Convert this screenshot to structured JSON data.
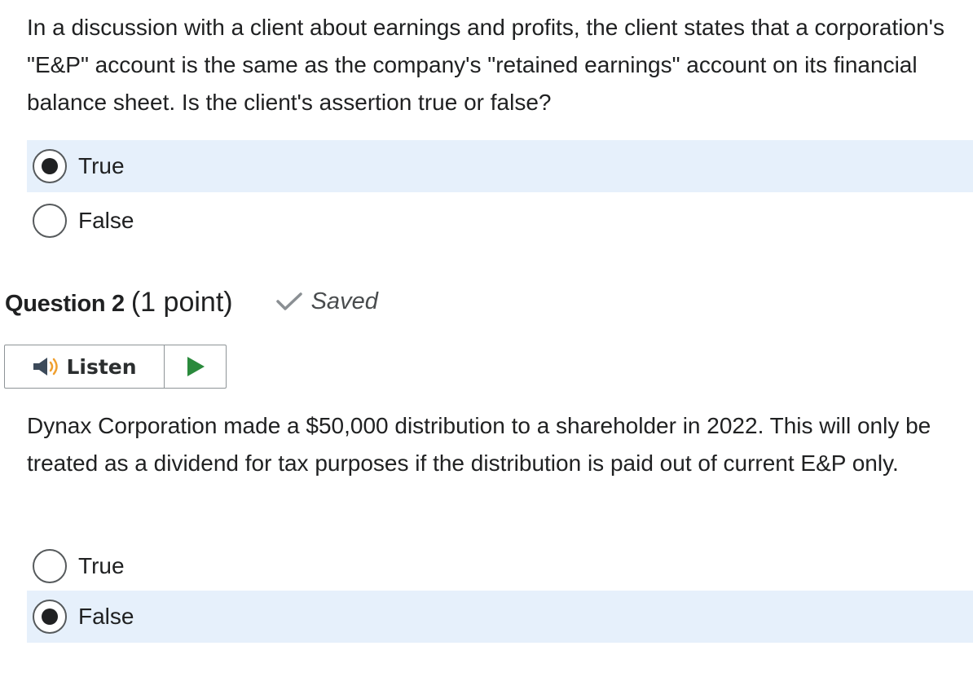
{
  "question1": {
    "text": "In a discussion with a client about earnings and profits, the client states that a corporation's \"E&P\" account is the same as the company's \"retained earnings\" account on its financial balance sheet. Is the client's assertion true or false?",
    "options": [
      {
        "label": "True",
        "selected": true
      },
      {
        "label": "False",
        "selected": false
      }
    ]
  },
  "question2": {
    "number_label": "Question 2",
    "points_label": "(1 point)",
    "status_label": "Saved",
    "listen_label": "Listen",
    "text": "Dynax Corporation made a $50,000 distribution to a shareholder in 2022. This will only be treated as a dividend for tax purposes if the distribution is paid out of current E&P only.",
    "options": [
      {
        "label": "True",
        "selected": false
      },
      {
        "label": "False",
        "selected": true
      }
    ]
  },
  "icons": {
    "saved": "check-icon",
    "listen": "speaker-icon",
    "play": "play-icon"
  },
  "colors": {
    "selected_background": "#e6f0fb",
    "play_green": "#2a8a3c",
    "speaker_orange": "#f0a030",
    "speaker_body": "#3c4a5a"
  }
}
